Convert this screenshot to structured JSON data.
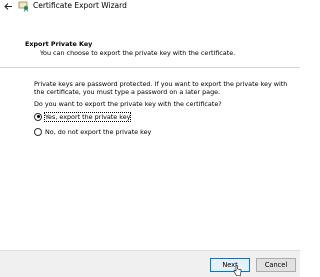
{
  "window": {
    "title": "Certificate Export Wizard",
    "back_icon": "back-arrow-icon",
    "app_icon": "certificate-icon"
  },
  "header": {
    "title": "Export Private Key",
    "subtitle": "You can choose to export the private key with the certificate."
  },
  "body": {
    "info": "Private keys are password protected. If you want to export the private key with the certificate, you must type a password on a later page.",
    "question": "Do you want to export the private key with the certificate?",
    "options": [
      {
        "label": "Yes, export the private key",
        "selected": true
      },
      {
        "label": "No, do not export the private key",
        "selected": false
      }
    ]
  },
  "footer": {
    "next_label": "Next",
    "cancel_label": "Cancel"
  },
  "colors": {
    "focus_border": "#0078d7",
    "footer_bg": "#f0f0f0"
  }
}
